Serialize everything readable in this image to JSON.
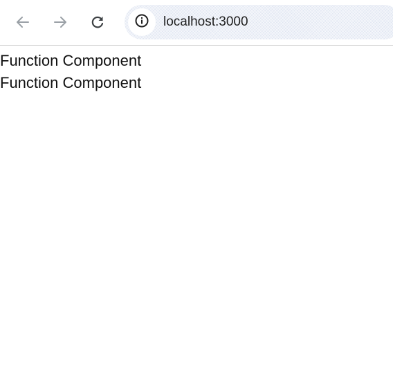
{
  "browser": {
    "url": "localhost:3000",
    "icons": {
      "back": "arrow-left-icon",
      "forward": "arrow-right-icon",
      "reload": "reload-icon",
      "site_info": "info-circle-icon"
    },
    "colors": {
      "icon_disabled": "#9aa0a6",
      "icon_active": "#3c4043",
      "omnibox_bg": "#eef1f8",
      "divider": "#d3d3d3"
    }
  },
  "page": {
    "lines": [
      "Function Component",
      "Function Component"
    ]
  }
}
